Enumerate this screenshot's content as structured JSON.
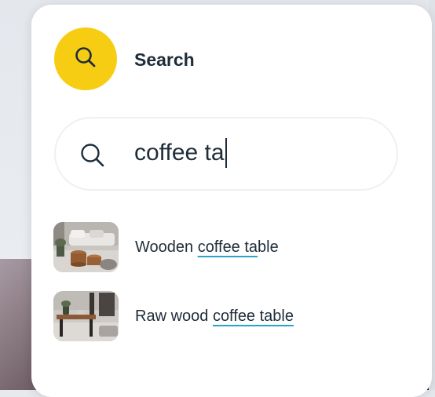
{
  "header": {
    "title": "Search",
    "icon": "search-icon",
    "badge_color": "#f7cd14"
  },
  "search": {
    "icon": "search-icon",
    "value": "coffee ta"
  },
  "suggestions": [
    {
      "prefix": "Wooden ",
      "match": "coffee ta",
      "suffix": "ble",
      "thumbnail": "living-room-thumbnail"
    },
    {
      "prefix": "Raw wood ",
      "match": "coffee table",
      "suffix": "",
      "thumbnail": "raw-wood-table-thumbnail"
    }
  ],
  "colors": {
    "accent": "#f7cd14",
    "highlight_underline": "#2aa3c7",
    "text": "#1f2d3a"
  }
}
